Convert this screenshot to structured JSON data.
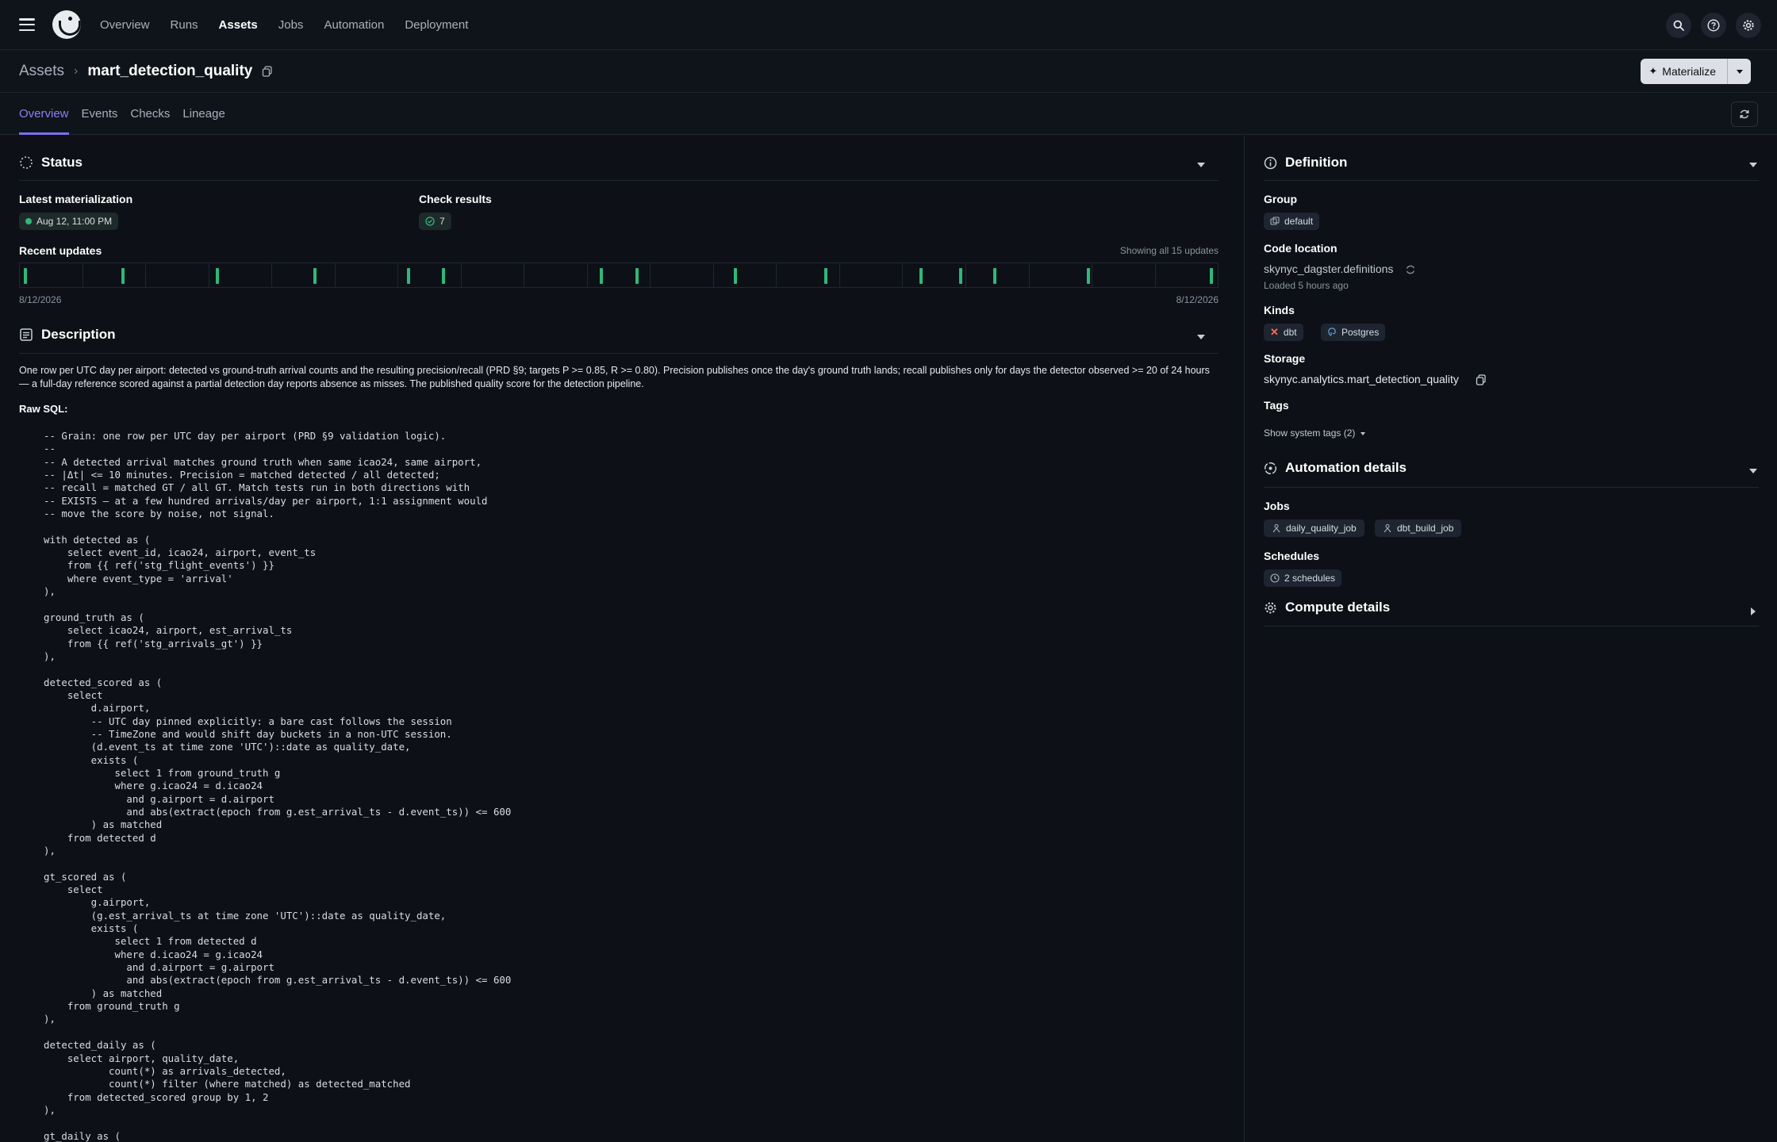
{
  "nav": {
    "items": [
      "Overview",
      "Runs",
      "Assets",
      "Jobs",
      "Automation",
      "Deployment"
    ],
    "active": "Assets"
  },
  "header": {
    "breadcrumb_root": "Assets",
    "asset_name": "mart_detection_quality",
    "materialize_label": "Materialize"
  },
  "tabs": [
    "Overview",
    "Events",
    "Checks",
    "Lineage"
  ],
  "status": {
    "title": "Status",
    "latest_materialization_label": "Latest materialization",
    "latest_materialization_value": "Aug 12, 11:00 PM",
    "check_results_label": "Check results",
    "check_results_value": "7",
    "recent_updates_label": "Recent updates",
    "showing_label": "Showing all 15 updates",
    "start_date": "8/12/2026",
    "end_date": "8/12/2026"
  },
  "description": {
    "title": "Description",
    "text": "One row per UTC day per airport: detected vs ground-truth arrival counts and the resulting precision/recall (PRD §9; targets P >= 0.85, R >= 0.80). Precision publishes once the day's ground truth lands; recall publishes only for days the detector observed >= 20 of 24 hours — a full-day reference scored against a partial detection day reports absence as misses. The published quality score for the detection pipeline.",
    "raw_sql_label": "Raw SQL:",
    "sql": "-- Grain: one row per UTC day per airport (PRD §9 validation logic).\n--\n-- A detected arrival matches ground truth when same icao24, same airport,\n-- |Δt| <= 10 minutes. Precision = matched detected / all detected;\n-- recall = matched GT / all GT. Match tests run in both directions with\n-- EXISTS — at a few hundred arrivals/day per airport, 1:1 assignment would\n-- move the score by noise, not signal.\n\nwith detected as (\n    select event_id, icao24, airport, event_ts\n    from {{ ref('stg_flight_events') }}\n    where event_type = 'arrival'\n),\n\nground_truth as (\n    select icao24, airport, est_arrival_ts\n    from {{ ref('stg_arrivals_gt') }}\n),\n\ndetected_scored as (\n    select\n        d.airport,\n        -- UTC day pinned explicitly: a bare cast follows the session\n        -- TimeZone and would shift day buckets in a non-UTC session.\n        (d.event_ts at time zone 'UTC')::date as quality_date,\n        exists (\n            select 1 from ground_truth g\n            where g.icao24 = d.icao24\n              and g.airport = d.airport\n              and abs(extract(epoch from g.est_arrival_ts - d.event_ts)) <= 600\n        ) as matched\n    from detected d\n),\n\ngt_scored as (\n    select\n        g.airport,\n        (g.est_arrival_ts at time zone 'UTC')::date as quality_date,\n        exists (\n            select 1 from detected d\n            where d.icao24 = g.icao24\n              and d.airport = g.airport\n              and abs(extract(epoch from g.est_arrival_ts - d.event_ts)) <= 600\n        ) as matched\n    from ground_truth g\n),\n\ndetected_daily as (\n    select airport, quality_date,\n           count(*) as arrivals_detected,\n           count(*) filter (where matched) as detected_matched\n    from detected_scored group by 1, 2\n),\n\ngt_daily as ("
  },
  "definition": {
    "title": "Definition",
    "group_label": "Group",
    "group_value": "default",
    "code_location_label": "Code location",
    "code_location_value": "skynyc_dagster.definitions",
    "loaded_text": "Loaded 5 hours ago",
    "kinds_label": "Kinds",
    "kinds": [
      "dbt",
      "Postgres"
    ],
    "storage_label": "Storage",
    "storage_value": "skynyc.analytics.mart_detection_quality",
    "tags_label": "Tags",
    "show_system_tags": "Show system tags (2)"
  },
  "automation": {
    "title": "Automation details",
    "jobs_label": "Jobs",
    "jobs": [
      "daily_quality_job",
      "dbt_build_job"
    ],
    "schedules_label": "Schedules",
    "schedules_value": "2 schedules"
  },
  "compute": {
    "title": "Compute details"
  },
  "colors": {
    "accent": "#7c6ff0",
    "success": "#2fb87a",
    "background": "#0d1117"
  }
}
